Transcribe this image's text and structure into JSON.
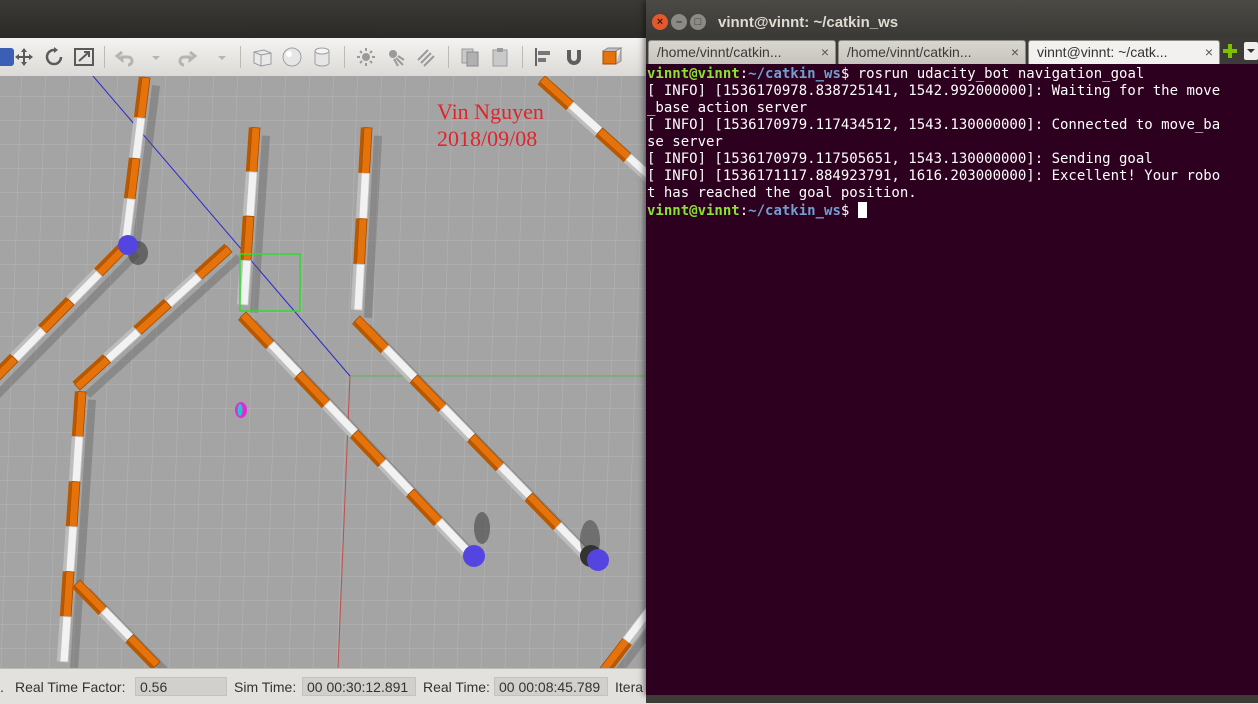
{
  "gazebo": {
    "watermark": {
      "line1": "Vin Nguyen",
      "line2": "2018/09/08"
    },
    "toolbar": {
      "tools": [
        "translate-icon",
        "rotate-icon",
        "scale-icon",
        "undo-icon",
        "redo-icon",
        "box-icon",
        "sphere-icon",
        "cylinder-icon",
        "point-light-icon",
        "spot-light-icon",
        "directional-light-icon",
        "copy-icon",
        "paste-icon",
        "align-icon",
        "magnet-icon",
        "view-angle-icon"
      ]
    },
    "status": {
      "lead_char": ".",
      "real_time_factor_label": "Real Time Factor:",
      "real_time_factor_value": "0.56",
      "sim_time_label": "Sim Time:",
      "sim_time_value": "00 00:30:12.891",
      "real_time_label": "Real Time:",
      "real_time_value": "00 00:08:45.789",
      "iterations_label": "Itera"
    },
    "colors": {
      "ground": "#a4a4a4",
      "wall_orange": "#e5720a",
      "wall_white": "#f2f2f2",
      "marker_blue": "#5545e0",
      "goal_box": "#2edc2e"
    }
  },
  "terminal": {
    "title": "vinnt@vinnt: ~/catkin_ws",
    "tabs": [
      {
        "label": "/home/vinnt/catkin...",
        "close": "×"
      },
      {
        "label": "/home/vinnt/catkin...",
        "close": "×"
      },
      {
        "label": "vinnt@vinnt: ~/catk...",
        "close": "×"
      }
    ],
    "prompt_user": "vinnt@vinnt",
    "prompt_sep": ":",
    "prompt_path": "~/catkin_ws",
    "prompt_end": "$ ",
    "command": "rosrun udacity_bot navigation_goal",
    "lines": [
      "[ INFO] [1536170978.838725141, 1542.992000000]: Waiting for the move",
      "_base action server",
      "[ INFO] [1536170979.117434512, 1543.130000000]: Connected to move_ba",
      "se server",
      "[ INFO] [1536170979.117505651, 1543.130000000]: Sending goal",
      "[ INFO] [1536171117.884923791, 1616.203000000]: Excellent! Your robo",
      "t has reached the goal position."
    ],
    "colors": {
      "background": "#2c001e",
      "user": "#8ae234",
      "path": "#729fcf"
    }
  }
}
